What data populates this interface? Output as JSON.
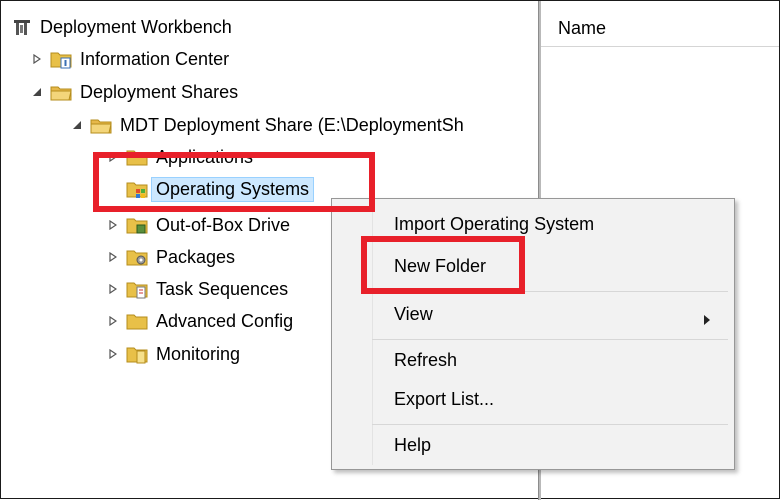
{
  "tree": {
    "root": {
      "label": "Deployment Workbench",
      "icon": "workbench-icon"
    },
    "items": [
      {
        "label": "Information Center",
        "expander": "collapsed",
        "icon": "folder-info-icon"
      },
      {
        "label": "Deployment Shares",
        "expander": "expanded",
        "icon": "folder-shares-icon"
      },
      {
        "label": "MDT Deployment Share (E:\\DeploymentSh",
        "expander": "expanded",
        "icon": "folder-share-icon"
      },
      {
        "label": "Applications",
        "expander": "collapsed",
        "icon": "folder-icon"
      },
      {
        "label": "Operating Systems",
        "expander": "none",
        "icon": "folder-os-icon",
        "selected": true
      },
      {
        "label": "Out-of-Box Drive",
        "expander": "collapsed",
        "icon": "folder-drivers-icon"
      },
      {
        "label": "Packages",
        "expander": "collapsed",
        "icon": "folder-packages-icon"
      },
      {
        "label": "Task Sequences",
        "expander": "collapsed",
        "icon": "folder-tasks-icon"
      },
      {
        "label": "Advanced Config",
        "expander": "collapsed",
        "icon": "folder-icon"
      },
      {
        "label": "Monitoring",
        "expander": "collapsed",
        "icon": "folder-monitor-icon"
      }
    ]
  },
  "list": {
    "column_name": "Name"
  },
  "context_menu": {
    "items": [
      {
        "label": "Import Operating System"
      },
      {
        "label": "New Folder"
      },
      {
        "label": "View",
        "submenu": true
      },
      {
        "label": "Refresh"
      },
      {
        "label": "Export List..."
      },
      {
        "label": "Help"
      }
    ],
    "submenu_arrow": "▶"
  },
  "highlight_color": "#e8202a"
}
